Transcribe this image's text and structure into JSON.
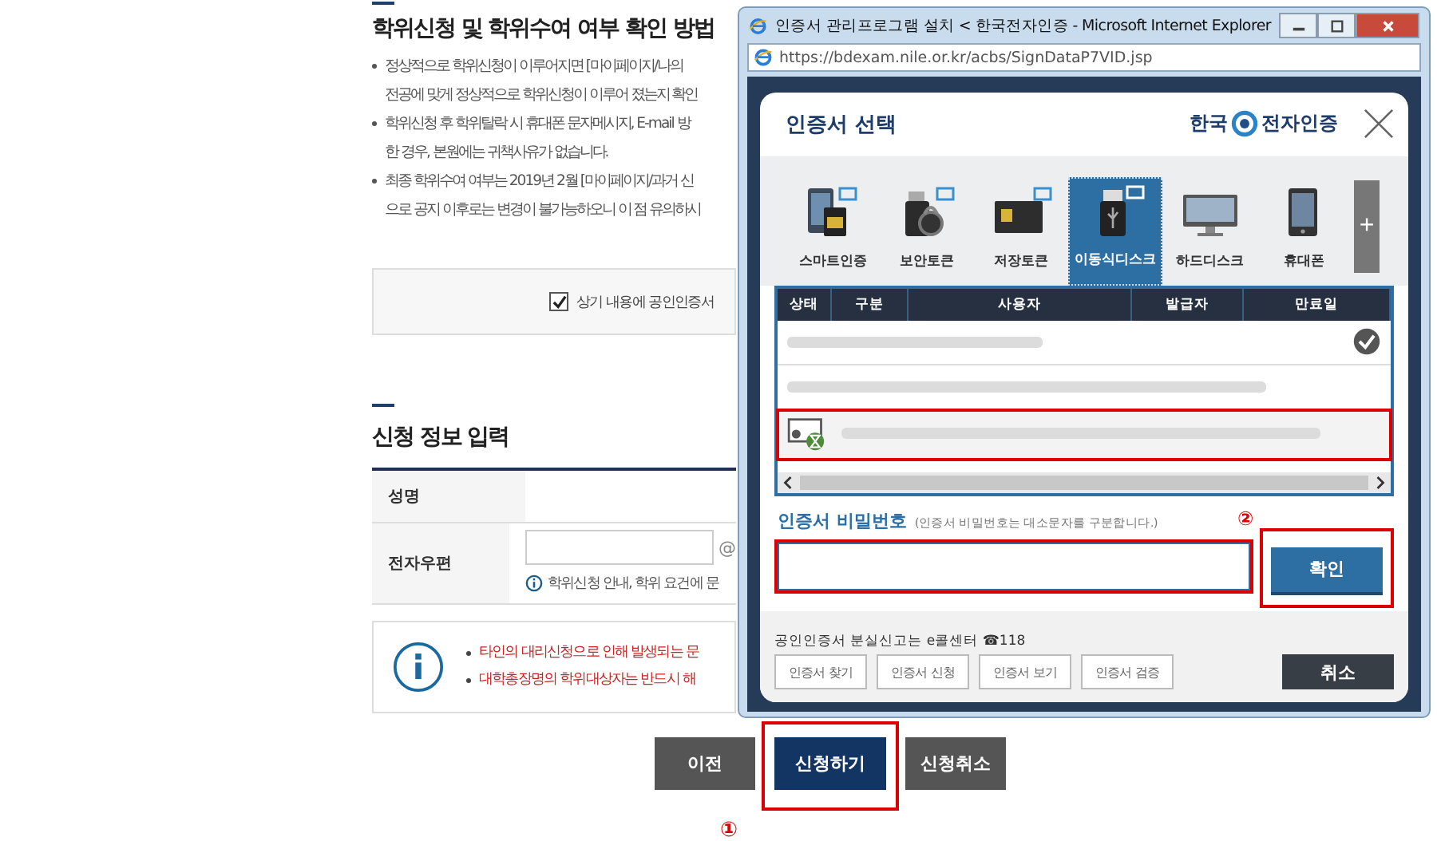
{
  "page": {
    "title": "학위신청 및 학위수여 여부 확인 방법",
    "bullets": [
      {
        "lines": [
          "정상적으로 학위신청이 이루어지면 [마이페이지/나의",
          "전공에 맞게 정상적으로 학위신청이 이루어 졌는지 확인"
        ]
      },
      {
        "lines": [
          "학위신청 후 학위탈락 시 휴대폰 문자메시지, E-mail 방",
          "한 경우, 본원에는 귀책사유가 없습니다."
        ]
      },
      {
        "lines": [
          "최종 학위수여 여부는 2019년 2월 [마이페이지/과거 신",
          "으로 공지 이후로는 변경이 불가능하오니 이 점 유의하시"
        ]
      }
    ],
    "agree": {
      "label": "상기 내용에 공인인증서",
      "checked": true
    },
    "section_title": "신청 정보 입력",
    "form": {
      "name_label": "성명",
      "email_label": "전자우편",
      "email_at": "@",
      "email_hint": "학위신청 안내, 학위 요건에 문"
    },
    "notices": [
      "타인의 대리신청으로 인해 발생되는 문",
      "대학총장명의 학위대상자는 반드시 해"
    ],
    "buttons": [
      {
        "label": "이전",
        "kind": "secondary",
        "highlighted": false
      },
      {
        "label": "신청하기",
        "kind": "primary",
        "highlighted": true
      },
      {
        "label": "신청취소",
        "kind": "secondary",
        "highlighted": false
      }
    ],
    "step_mark": "①"
  },
  "popup": {
    "window_title": "인증서 관리프로그램 설치 < 한국전자인증 - Microsoft Internet Explorer",
    "address": "https://bdexam.nile.or.kr/acbs/SignDataP7VID.jsp",
    "dialog_title": "인증서 선택",
    "logo_left": "한국",
    "logo_right": "전자인증",
    "storage_tabs": [
      {
        "label": "스마트인증",
        "kind": "smart",
        "selected": false
      },
      {
        "label": "보안토큰",
        "kind": "token",
        "selected": false
      },
      {
        "label": "저장토큰",
        "kind": "card",
        "selected": false
      },
      {
        "label": "이동식디스크",
        "kind": "usb",
        "selected": true
      },
      {
        "label": "하드디스크",
        "kind": "monitor",
        "selected": false
      },
      {
        "label": "휴대폰",
        "kind": "phone",
        "selected": false
      }
    ],
    "more_button": "+",
    "columns": [
      "상태",
      "구분",
      "사용자",
      "발급자",
      "만료일"
    ],
    "cert_rows": [
      {
        "kind": "check",
        "selected": false
      },
      {
        "kind": "blank",
        "selected": false
      },
      {
        "kind": "certificate",
        "selected": true
      }
    ],
    "password_label": "인증서 비밀번호",
    "password_hint": "(인증서 비밀번호는 대소문자를 구분합니다.)",
    "ok_button": "확인",
    "step_mark": "②",
    "lost_notice": "공인인증서 분실신고는 e콜센터 ☎118",
    "tool_buttons": [
      "인증서 찾기",
      "인증서 신청",
      "인증서 보기",
      "인증서 검증"
    ],
    "cancel_button": "취소"
  }
}
